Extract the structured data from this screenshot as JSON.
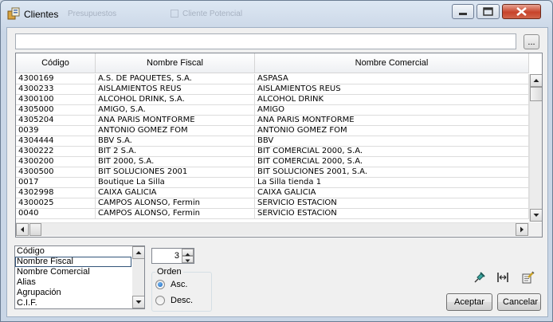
{
  "window": {
    "title": "Clientes",
    "background_title_text": "Presupuestos",
    "background_checkbox_label": "Cliente Potencial"
  },
  "search": {
    "value": "",
    "ellipsis_label": "..."
  },
  "grid": {
    "columns": [
      "Código",
      "Nombre Fiscal",
      "Nombre Comercial"
    ],
    "rows": [
      [
        "4300169",
        "A.S. DE PAQUETES, S.A.",
        "ASPASA"
      ],
      [
        "4300233",
        "AISLAMIENTOS REUS",
        "AISLAMIENTOS REUS"
      ],
      [
        "4300100",
        "ALCOHOL DRINK, S.A.",
        "ALCOHOL DRINK"
      ],
      [
        "4305000",
        "AMIGO, S.A.",
        "AMIGO"
      ],
      [
        "4305204",
        "ANA PARIS MONTFORME",
        "ANA PARIS MONTFORME"
      ],
      [
        "0039",
        "ANTONIO GOMEZ FOM",
        "ANTONIO GOMEZ FOM"
      ],
      [
        "4304444",
        "BBV S.A.",
        "BBV"
      ],
      [
        "4300222",
        "BIT 2 S.A.",
        "BIT COMERCIAL 2000, S.A."
      ],
      [
        "4300200",
        "BIT 2000, S.A.",
        "BIT COMERCIAL 2000, S.A."
      ],
      [
        "4300500",
        "BIT SOLUCIONES 2001",
        "BIT SOLUCIONES 2001, S.A."
      ],
      [
        "0017",
        "Boutique La Silla",
        "La Silla tienda 1"
      ],
      [
        "4302998",
        "CAIXA GALICIA",
        "CAIXA GALICIA"
      ],
      [
        "4300025",
        "CAMPOS ALONSO, Fermin",
        "SERVICIO ESTACION"
      ],
      [
        "0040",
        "CAMPOS ALONSO, Fermin",
        "SERVICIO ESTACION"
      ]
    ]
  },
  "sort_fields": {
    "items": [
      "Código",
      "Nombre Fiscal",
      "Nombre Comercial",
      "Alias",
      "Agrupación",
      "C.I.F."
    ],
    "selected": "Nombre Fiscal"
  },
  "spinner": {
    "value": "3"
  },
  "order": {
    "legend": "Orden",
    "options": [
      "Asc.",
      "Desc."
    ],
    "selected": "Asc."
  },
  "buttons": {
    "accept": "Aceptar",
    "cancel": "Cancelar"
  },
  "icons": [
    "app-icon",
    "minimize-icon",
    "maximize-icon",
    "close-icon",
    "pin-icon",
    "fit-columns-icon",
    "properties-icon"
  ]
}
